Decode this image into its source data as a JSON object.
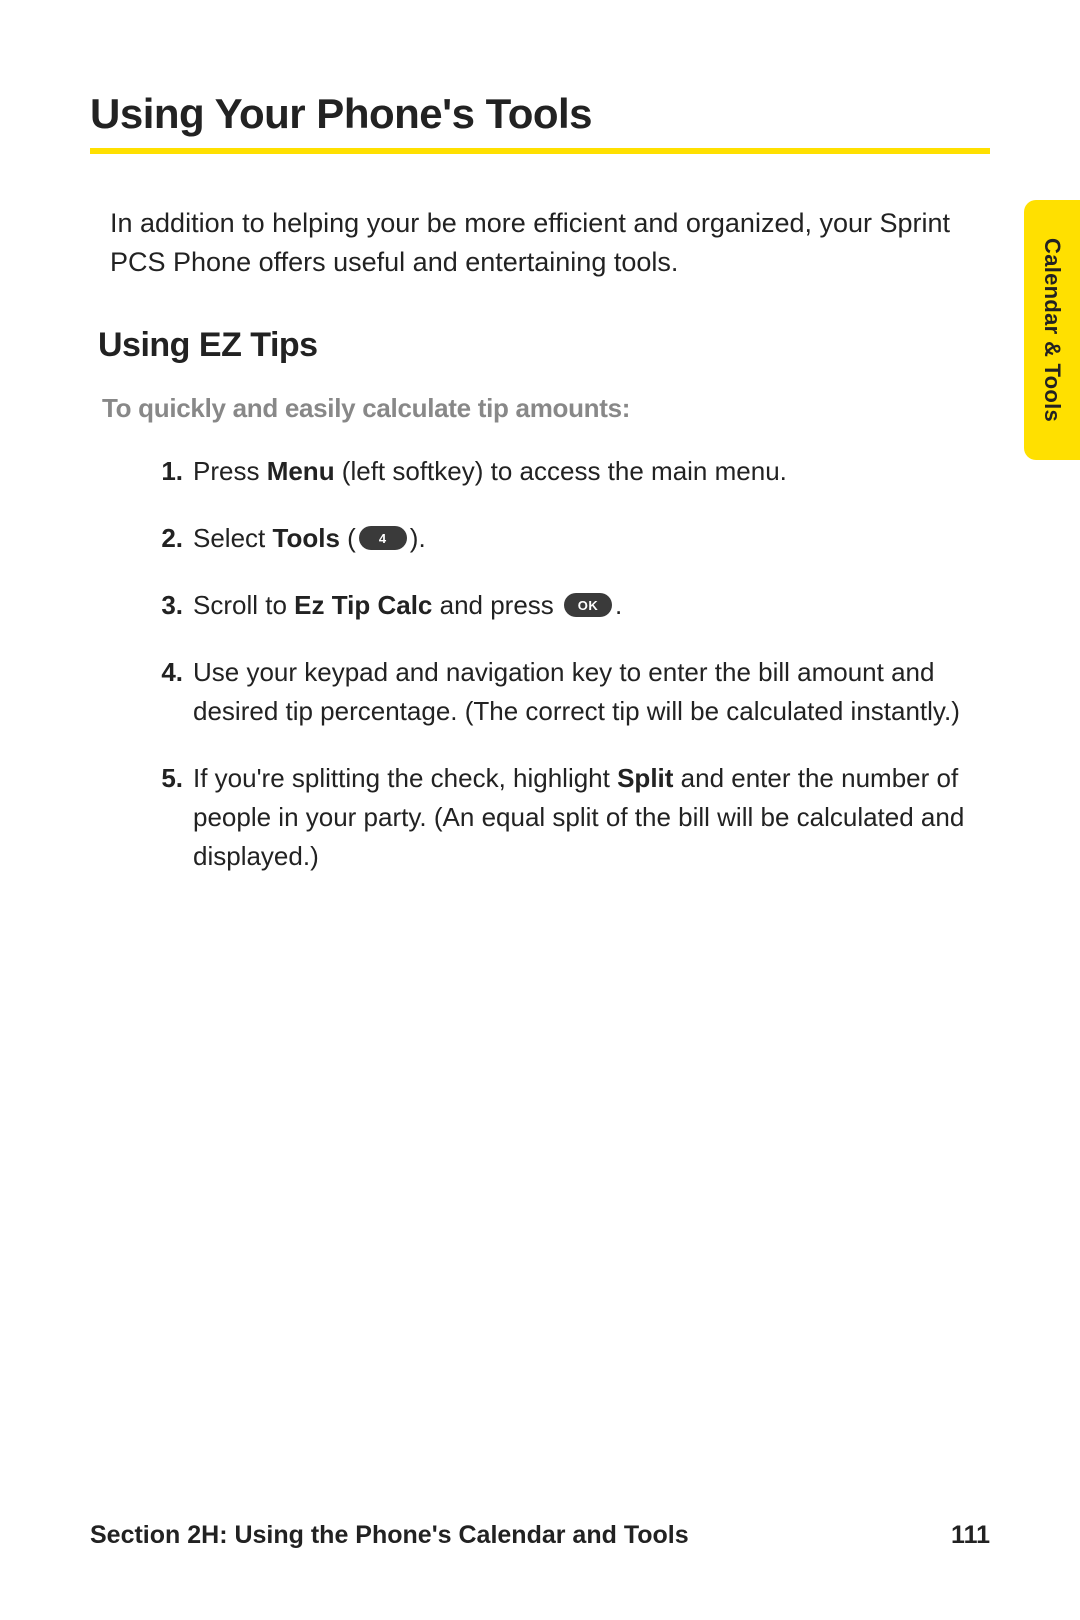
{
  "title": "Using Your Phone's Tools",
  "intro": "In addition to helping your be more efficient and organized, your Sprint PCS Phone offers useful and entertaining tools.",
  "section_heading": "Using EZ Tips",
  "lead_line": "To quickly and easily calculate tip amounts:",
  "steps": {
    "s1": {
      "num": "1.",
      "a": "Press ",
      "b1": "Menu",
      "c": " (left softkey) to access the main menu."
    },
    "s2": {
      "num": "2.",
      "a": "Select ",
      "b1": "Tools",
      "c": " (",
      "key": "4",
      "d": ")."
    },
    "s3": {
      "num": "3.",
      "a": "Scroll to ",
      "b1": "Ez Tip Calc",
      "c": " and press ",
      "key": "OK",
      "d": "."
    },
    "s4": {
      "num": "4.",
      "a": "Use your keypad and navigation key to enter the bill amount and desired tip percentage. (The correct tip will be calculated instantly.)"
    },
    "s5": {
      "num": "5.",
      "a": "If you're splitting the check, highlight ",
      "b1": "Split",
      "c": " and enter the number of people in your party. (An equal split of the bill will be calculated and displayed.)"
    }
  },
  "side_tab": "Calendar & Tools",
  "footer": {
    "section": "Section 2H: Using the Phone's Calendar and Tools",
    "page": "111"
  }
}
